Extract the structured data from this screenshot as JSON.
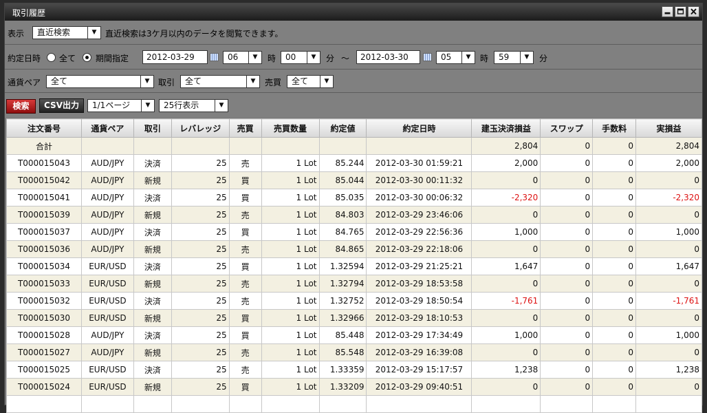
{
  "window": {
    "title": "取引履歴"
  },
  "row1": {
    "display_label": "表示",
    "mode_value": "直近検索",
    "notice": "直近検索は3ケ月以内のデータを閲覧できます。"
  },
  "row2": {
    "date_label": "約定日時",
    "all_label": "全て",
    "range_label": "期間指定",
    "from_date": "2012-03-29",
    "from_hour": "06",
    "hour_label": "時",
    "from_min": "00",
    "min_label": "分",
    "tilde": "～",
    "to_date": "2012-03-30",
    "to_hour": "05",
    "to_min": "59"
  },
  "row3": {
    "pair_label": "通貨ペア",
    "pair_value": "全て",
    "trade_label": "取引",
    "trade_value": "全て",
    "side_label": "売買",
    "side_value": "全て"
  },
  "row4": {
    "search_label": "検索",
    "csv_label": "CSV出力",
    "page_value": "1/1ページ",
    "rows_value": "25行表示"
  },
  "table": {
    "headers": [
      "注文番号",
      "通貨ペア",
      "取引",
      "レバレッジ",
      "売買",
      "売買数量",
      "約定値",
      "約定日時",
      "建玉決済損益",
      "スワップ",
      "手数料",
      "実損益"
    ],
    "total": [
      "合計",
      "",
      "",
      "",
      "",
      "",
      "",
      "",
      "2,804",
      "0",
      "0",
      "2,804"
    ],
    "rows": [
      [
        "T000015043",
        "AUD/JPY",
        "決済",
        "25",
        "売",
        "1 Lot",
        "85.244",
        "2012-03-30 01:59:21",
        "2,000",
        "0",
        "0",
        "2,000"
      ],
      [
        "T000015042",
        "AUD/JPY",
        "新規",
        "25",
        "買",
        "1 Lot",
        "85.044",
        "2012-03-30 00:11:32",
        "0",
        "0",
        "0",
        "0"
      ],
      [
        "T000015041",
        "AUD/JPY",
        "決済",
        "25",
        "買",
        "1 Lot",
        "85.035",
        "2012-03-30 00:06:32",
        "-2,320",
        "0",
        "0",
        "-2,320"
      ],
      [
        "T000015039",
        "AUD/JPY",
        "新規",
        "25",
        "売",
        "1 Lot",
        "84.803",
        "2012-03-29 23:46:06",
        "0",
        "0",
        "0",
        "0"
      ],
      [
        "T000015037",
        "AUD/JPY",
        "決済",
        "25",
        "買",
        "1 Lot",
        "84.765",
        "2012-03-29 22:56:36",
        "1,000",
        "0",
        "0",
        "1,000"
      ],
      [
        "T000015036",
        "AUD/JPY",
        "新規",
        "25",
        "売",
        "1 Lot",
        "84.865",
        "2012-03-29 22:18:06",
        "0",
        "0",
        "0",
        "0"
      ],
      [
        "T000015034",
        "EUR/USD",
        "決済",
        "25",
        "買",
        "1 Lot",
        "1.32594",
        "2012-03-29 21:25:21",
        "1,647",
        "0",
        "0",
        "1,647"
      ],
      [
        "T000015033",
        "EUR/USD",
        "新規",
        "25",
        "売",
        "1 Lot",
        "1.32794",
        "2012-03-29 18:53:58",
        "0",
        "0",
        "0",
        "0"
      ],
      [
        "T000015032",
        "EUR/USD",
        "決済",
        "25",
        "売",
        "1 Lot",
        "1.32752",
        "2012-03-29 18:50:54",
        "-1,761",
        "0",
        "0",
        "-1,761"
      ],
      [
        "T000015030",
        "EUR/USD",
        "新規",
        "25",
        "買",
        "1 Lot",
        "1.32966",
        "2012-03-29 18:10:53",
        "0",
        "0",
        "0",
        "0"
      ],
      [
        "T000015028",
        "AUD/JPY",
        "決済",
        "25",
        "買",
        "1 Lot",
        "85.448",
        "2012-03-29 17:34:49",
        "1,000",
        "0",
        "0",
        "1,000"
      ],
      [
        "T000015027",
        "AUD/JPY",
        "新規",
        "25",
        "売",
        "1 Lot",
        "85.548",
        "2012-03-29 16:39:08",
        "0",
        "0",
        "0",
        "0"
      ],
      [
        "T000015025",
        "EUR/USD",
        "決済",
        "25",
        "売",
        "1 Lot",
        "1.33359",
        "2012-03-29 15:17:57",
        "1,238",
        "0",
        "0",
        "1,238"
      ],
      [
        "T000015024",
        "EUR/USD",
        "新規",
        "25",
        "買",
        "1 Lot",
        "1.33209",
        "2012-03-29 09:40:51",
        "0",
        "0",
        "0",
        "0"
      ]
    ]
  },
  "colors": {
    "negative": "#dd1111",
    "row_alt": "#f3f0e1",
    "search_button": "#c42020"
  },
  "icons": [
    "minimize-icon",
    "maximize-icon",
    "close-icon",
    "calendar-icon",
    "chevron-down-icon",
    "radio-icon"
  ]
}
